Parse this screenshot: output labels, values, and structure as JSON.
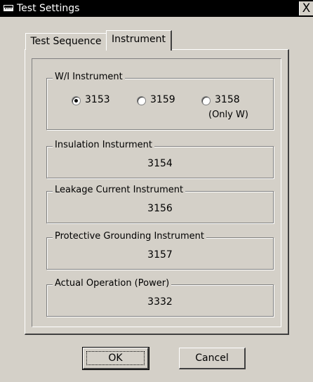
{
  "window": {
    "title": "Test Settings",
    "close_label": "X"
  },
  "tabs": [
    {
      "label": "Test Sequence",
      "active": false
    },
    {
      "label": "Instrument",
      "active": true
    }
  ],
  "wi_instrument": {
    "legend": "W/I Instrument",
    "options": [
      {
        "label": "3153",
        "selected": true,
        "note": ""
      },
      {
        "label": "3159",
        "selected": false,
        "note": ""
      },
      {
        "label": "3158",
        "selected": false,
        "note": "(Only W)"
      }
    ]
  },
  "insulation": {
    "legend": "Insulation Insturment",
    "value": "3154"
  },
  "leakage": {
    "legend": "Leakage Current Instrument",
    "value": "3156"
  },
  "grounding": {
    "legend": "Protective Grounding Instrument",
    "value": "3157"
  },
  "actual_operation": {
    "legend": "Actual Operation (Power)",
    "value": "3332"
  },
  "buttons": {
    "ok": "OK",
    "cancel": "Cancel"
  }
}
